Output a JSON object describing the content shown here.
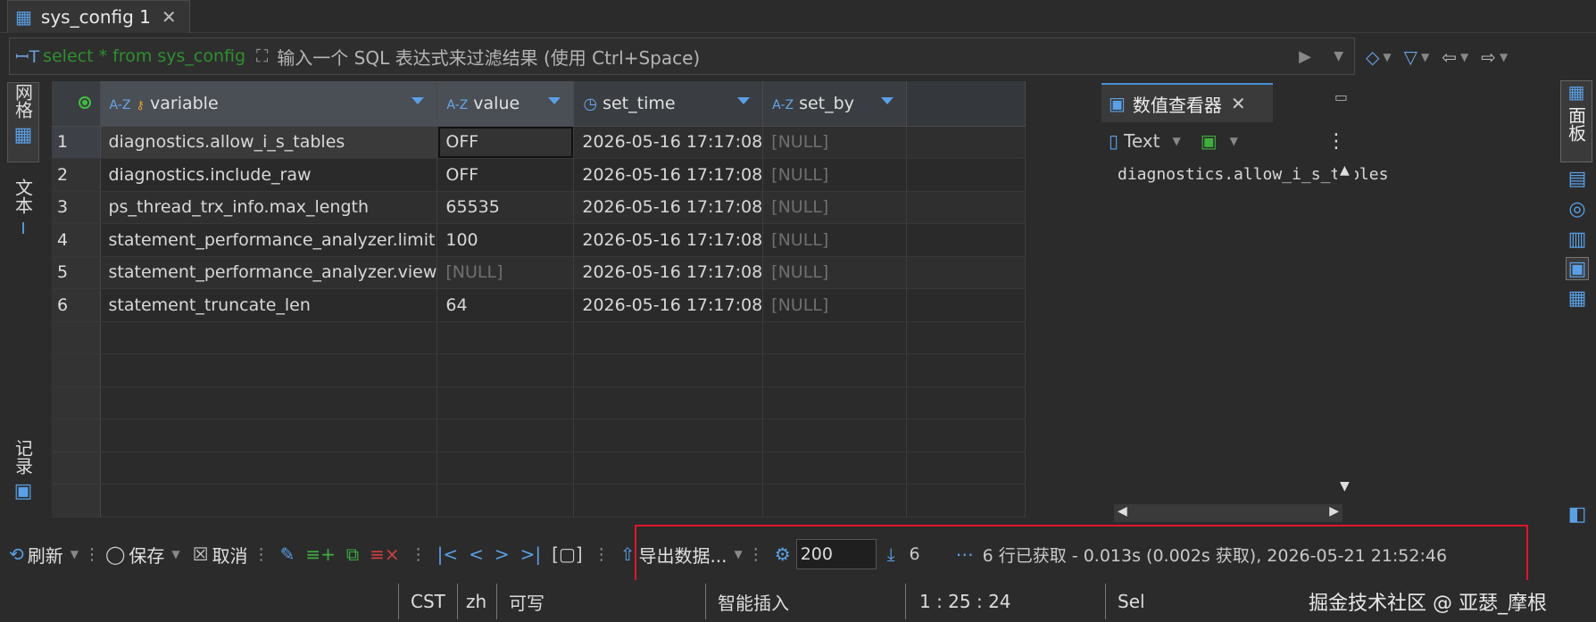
{
  "tab": {
    "label": "sys_config 1"
  },
  "filter": {
    "sql": "select * from sys_config",
    "placeholder": "输入一个 SQL 表达式来过滤结果 (使用 Ctrl+Space)"
  },
  "left_tabs": {
    "grid": "网格",
    "text": "文本",
    "record": "记录"
  },
  "grid": {
    "columns": [
      "variable",
      "value",
      "set_time",
      "set_by"
    ],
    "rows": [
      {
        "n": "1",
        "variable": "diagnostics.allow_i_s_tables",
        "value": "OFF",
        "set_time": "2026-05-16 17:17:08",
        "set_by": "[NULL]"
      },
      {
        "n": "2",
        "variable": "diagnostics.include_raw",
        "value": "OFF",
        "set_time": "2026-05-16 17:17:08",
        "set_by": "[NULL]"
      },
      {
        "n": "3",
        "variable": "ps_thread_trx_info.max_length",
        "value": "65535",
        "set_time": "2026-05-16 17:17:08",
        "set_by": "[NULL]"
      },
      {
        "n": "4",
        "variable": "statement_performance_analyzer.limit",
        "value": "100",
        "set_time": "2026-05-16 17:17:08",
        "set_by": "[NULL]"
      },
      {
        "n": "5",
        "variable": "statement_performance_analyzer.view",
        "value": "[NULL]",
        "set_time": "2026-05-16 17:17:08",
        "set_by": "[NULL]"
      },
      {
        "n": "6",
        "variable": "statement_truncate_len",
        "value": "64",
        "set_time": "2026-05-16 17:17:08",
        "set_by": "[NULL]"
      }
    ]
  },
  "viewer": {
    "title": "数值查看器",
    "format": "Text",
    "content": "diagnostics.allow_i_s_tables"
  },
  "right_panel": {
    "label": "面板"
  },
  "toolbar": {
    "refresh": "刷新",
    "save": "保存",
    "cancel": "取消",
    "export": "导出数据...",
    "fetch_size": "200",
    "row_count": "6",
    "status": "6 行已获取 - 0.013s (0.002s 获取), 2026-05-21 21:52:46"
  },
  "statusbar": {
    "timezone": "CST",
    "locale": "zh",
    "mode": "可写",
    "insert": "智能插入",
    "position": "1 : 25 : 24",
    "sel": "Sel",
    "watermark": "掘金技术社区 @ 亚瑟_摩根"
  },
  "colors": {
    "accent": "#5aa0e6",
    "highlight_box": "#e0162b",
    "sql": "#2f8f2f",
    "null_text": "#6f6f6f"
  }
}
